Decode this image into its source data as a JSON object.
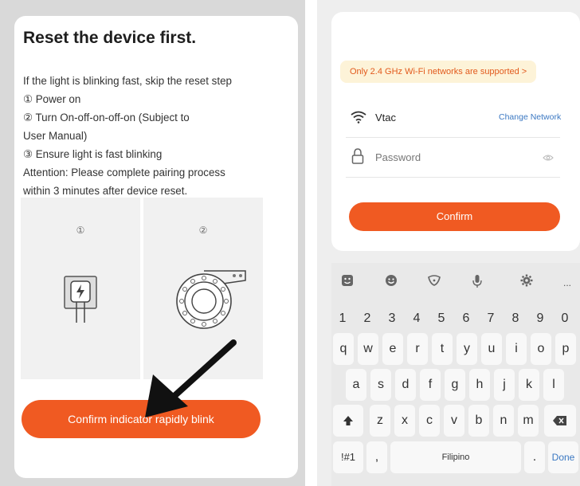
{
  "reset": {
    "title": "Reset the device first.",
    "lines": [
      "If the light is blinking fast, skip the reset step",
      "① Power on",
      "② Turn On-off-on-off-on (Subject to",
      "User Manual)",
      "③ Ensure light is fast blinking",
      "Attention: Please complete pairing process",
      "within 3 minutes after device reset."
    ],
    "steps": [
      "①",
      "②"
    ],
    "confirm_label": "Confirm indicator rapidly blink"
  },
  "wifi": {
    "tip": "Only 2.4 GHz Wi-Fi networks are supported >",
    "ssid": "Vtac",
    "change_network": "Change Network",
    "password_placeholder": "Password",
    "confirm_label": "Confirm"
  },
  "keyboard": {
    "numbers": [
      "1",
      "2",
      "3",
      "4",
      "5",
      "6",
      "7",
      "8",
      "9",
      "0"
    ],
    "row1": [
      "q",
      "w",
      "e",
      "r",
      "t",
      "y",
      "u",
      "i",
      "o",
      "p"
    ],
    "row2": [
      "a",
      "s",
      "d",
      "f",
      "g",
      "h",
      "j",
      "k",
      "l"
    ],
    "row3": [
      "z",
      "x",
      "c",
      "v",
      "b",
      "n",
      "m"
    ],
    "symbols_label": "!#1",
    "comma_label": ",",
    "space_label": "Filipino",
    "period_label": ".",
    "done_label": "Done",
    "more_label": "..."
  },
  "colors": {
    "accent": "#f05a22",
    "link": "#3b78c2",
    "tip_bg": "#fdf3d8"
  }
}
